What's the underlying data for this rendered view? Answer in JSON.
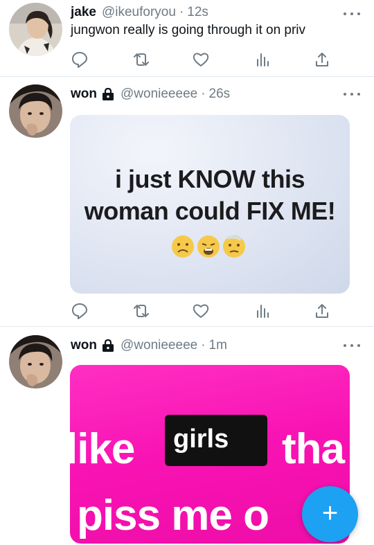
{
  "tweets": [
    {
      "name": "jake",
      "handle": "@ikeuforyou",
      "time": "12s",
      "text": "jungwon really is going through it on priv",
      "locked": false
    },
    {
      "name": "won",
      "handle": "@wonieeeee",
      "time": "26s",
      "locked": true,
      "media": {
        "line1": "i just KNOW this",
        "line2": "woman could FIX ME!"
      }
    },
    {
      "name": "won",
      "handle": "@wonieeeee",
      "time": "1m",
      "locked": true,
      "media": {
        "word1": "like",
        "word2": "girls",
        "word3": "tha",
        "line2": "piss me o"
      }
    }
  ],
  "compose": {
    "icon": "+"
  },
  "icons": [
    "reply-icon",
    "retweet-icon",
    "like-icon",
    "analytics-icon",
    "share-icon",
    "more-icon",
    "lock-icon"
  ],
  "colors": {
    "accent": "#1da1f2",
    "secondary_text": "#6e7b85",
    "media_pink": "#f812b3"
  }
}
